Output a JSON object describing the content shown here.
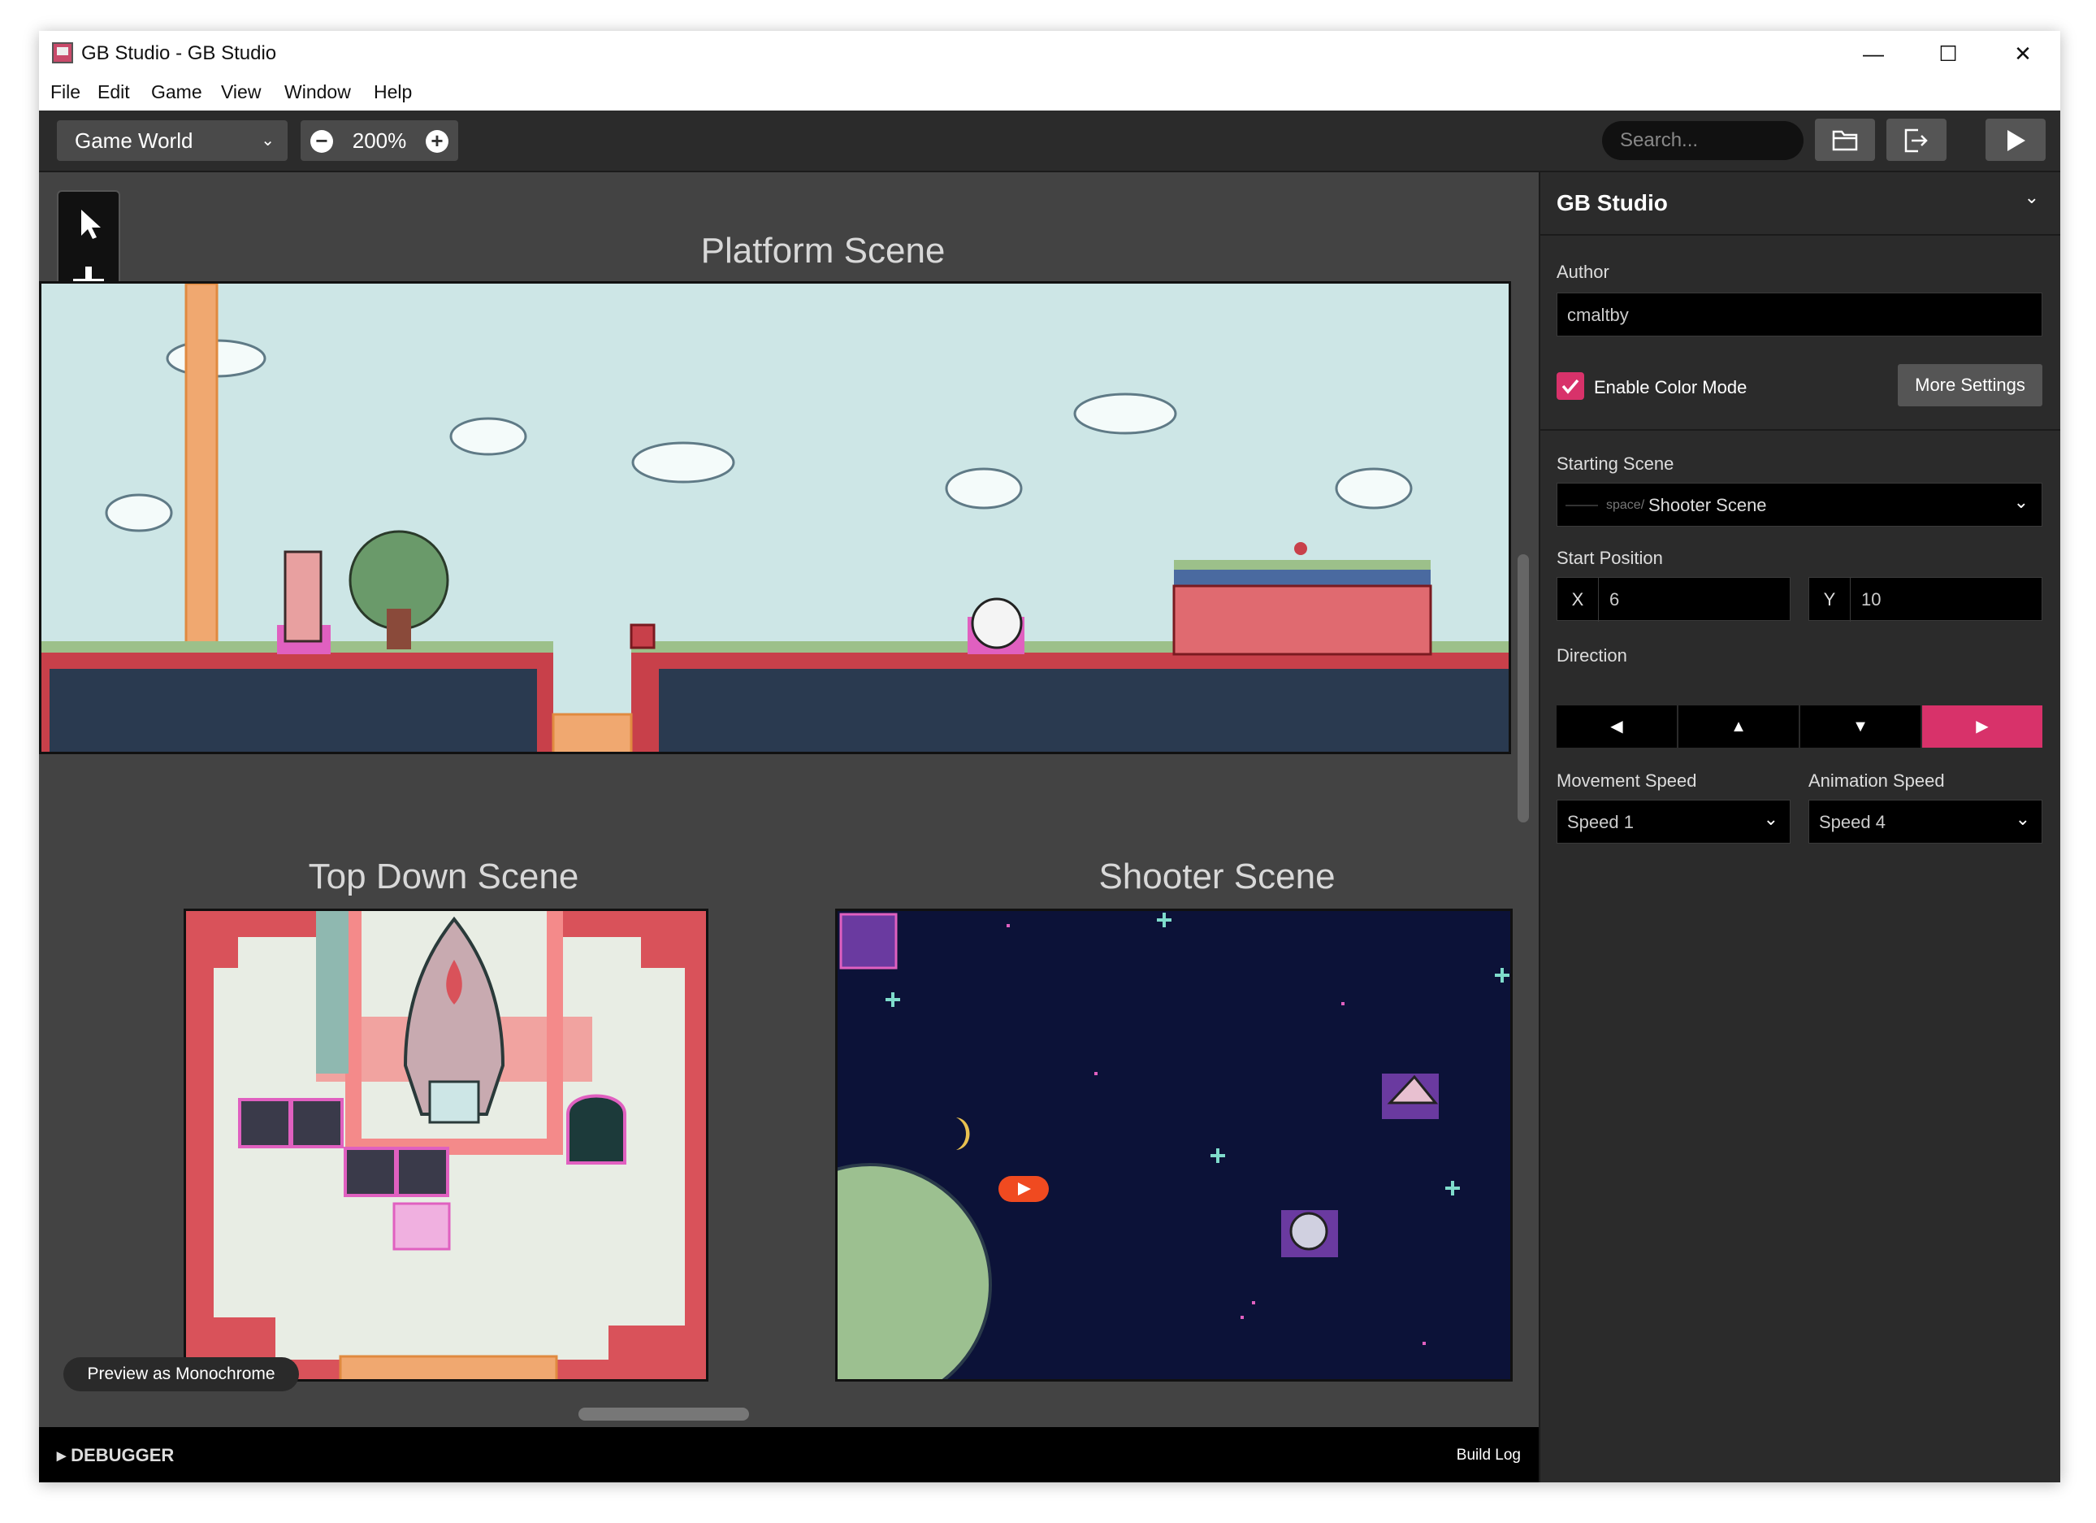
{
  "window": {
    "title": "GB Studio - GB Studio",
    "controls": {
      "minimize": "—",
      "maximize": "☐",
      "close": "✕"
    }
  },
  "menu": [
    "File",
    "Edit",
    "Game",
    "View",
    "Window",
    "Help"
  ],
  "toolbar": {
    "view_select": "Game World",
    "zoom_out": "−",
    "zoom": "200%",
    "zoom_in": "+",
    "search_placeholder": "Search...",
    "icons": [
      "folder-icon",
      "export-icon",
      "play-icon"
    ]
  },
  "tools": [
    "select-icon",
    "add-icon",
    "eraser-icon",
    "brick-icon",
    "palette-icon",
    "list-icon"
  ],
  "scenes": {
    "platform": "Platform Scene",
    "topdown": "Top Down Scene",
    "shooter": "Shooter Scene"
  },
  "canvas": {
    "preview_button": "Preview as Monochrome"
  },
  "bottom": {
    "debugger": "DEBUGGER",
    "build_log": "Build Log"
  },
  "panel": {
    "title": "GB Studio",
    "author_label": "Author",
    "author_value": "cmaltby",
    "color_mode_label": "Enable Color Mode",
    "more_settings": "More Settings",
    "starting_scene_label": "Starting Scene",
    "starting_scene_prefix": "space/",
    "starting_scene_value": "Shooter Scene",
    "start_position_label": "Start Position",
    "x_label": "X",
    "x_value": "6",
    "y_label": "Y",
    "y_value": "10",
    "direction_label": "Direction",
    "directions": [
      "◀",
      "▲",
      "▼",
      "▶"
    ],
    "movement_speed_label": "Movement Speed",
    "movement_speed_value": "Speed 1",
    "animation_speed_label": "Animation Speed",
    "animation_speed_value": "Speed 4"
  },
  "colors": {
    "accent": "#d8326a",
    "sky": "#cde6e6",
    "space": "#0c1238",
    "brick": "#c0353a"
  }
}
